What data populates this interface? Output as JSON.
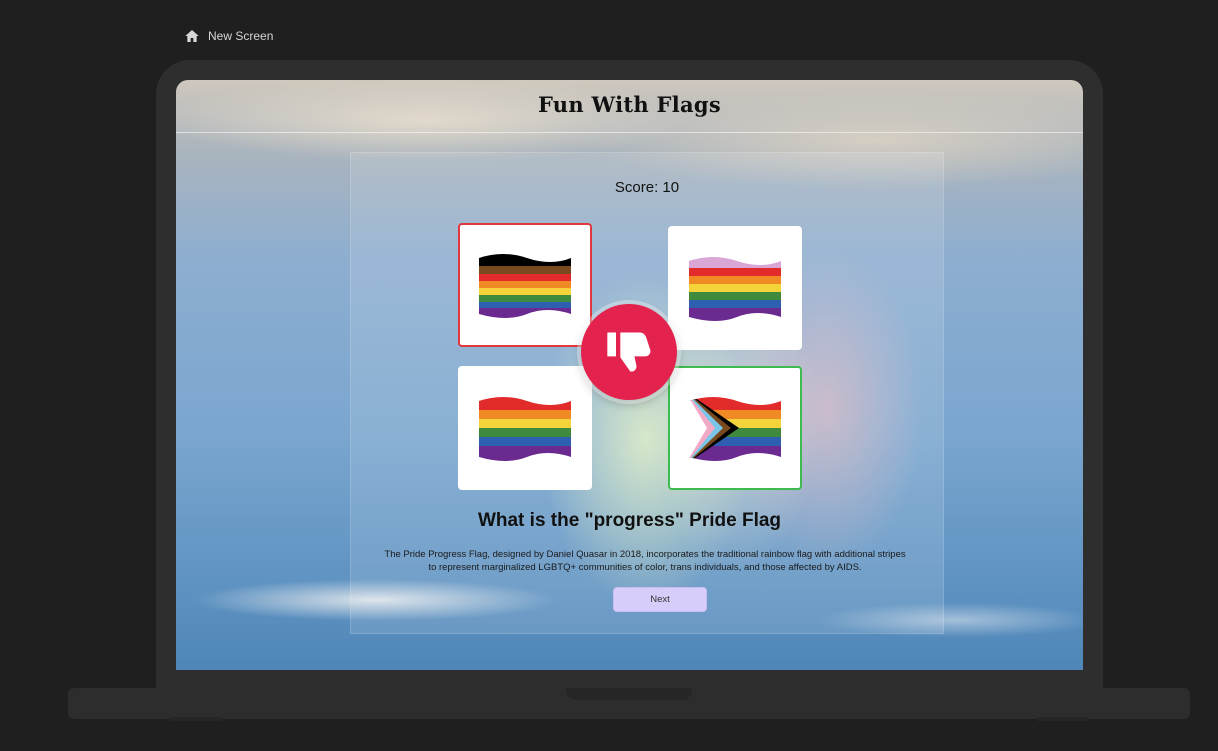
{
  "breadcrumb": {
    "icon": "home-icon",
    "label": "New Screen"
  },
  "app": {
    "title": "Fun With Flags"
  },
  "quiz": {
    "score_text": "Score: 10",
    "question": "What is the \"progress\" Pride Flag",
    "explanation": "The Pride Progress Flag, designed by Daniel Quasar in 2018, incorporates the traditional rainbow flag with additional stripes to represent marginalized LGBTQ+ communities of color, trans individuals, and those affected by AIDS.",
    "next_label": "Next",
    "result_icon": "thumbs-down-icon",
    "options": [
      {
        "flag": "philadelphia-pride-flag-icon",
        "state": "wrong"
      },
      {
        "flag": "lavender-rainbow-flag-icon",
        "state": "neutral"
      },
      {
        "flag": "rainbow-pride-flag-icon",
        "state": "neutral"
      },
      {
        "flag": "progress-pride-flag-icon",
        "state": "correct"
      }
    ]
  },
  "colors": {
    "wrong_border": "#e0383e",
    "correct_border": "#3dbb4f",
    "badge": "#e3224d",
    "next_button": "#d6cdfb"
  }
}
